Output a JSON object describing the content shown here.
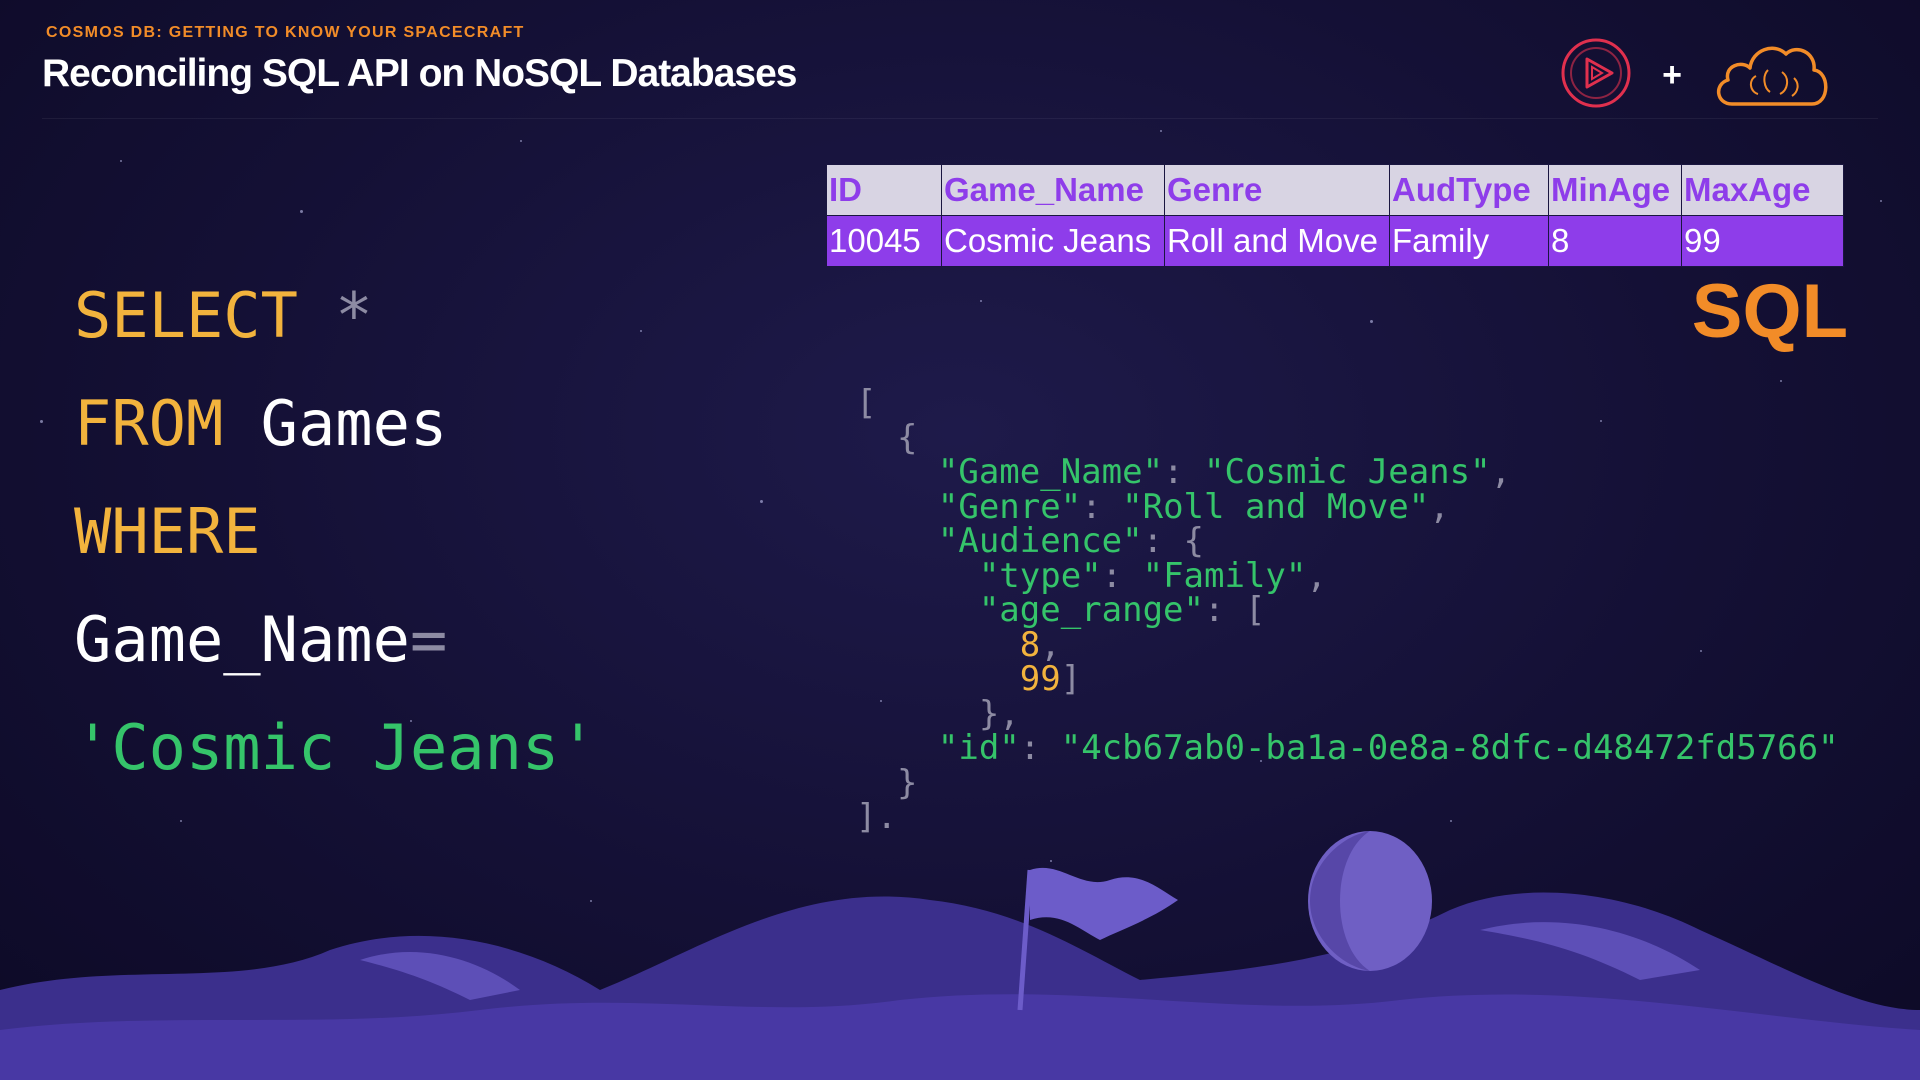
{
  "header": {
    "kicker": "COSMOS DB: GETTING TO KNOW YOUR SPACECRAFT",
    "title": "Reconciling SQL API on NoSQL Databases"
  },
  "logos": {
    "play_icon": "pluralsight-play-icon",
    "plus": "+",
    "cloud_icon": "cloud-brain-icon"
  },
  "sql_query": {
    "select_kw": "SELECT",
    "star": "*",
    "from_kw": "FROM",
    "table": "Games",
    "where_kw": "WHERE",
    "column": "Game_Name",
    "equals": "=",
    "value": "'Cosmic Jeans'"
  },
  "result_table": {
    "columns": [
      "ID",
      "Game_Name",
      "Genre",
      "AudType",
      "MinAge",
      "MaxAge"
    ],
    "rows": [
      [
        "10045",
        "Cosmic Jeans",
        "Roll and Move",
        "Family",
        "8",
        "99"
      ]
    ]
  },
  "sql_badge": "SQL",
  "json_doc": {
    "open_bracket": "[",
    "open_brace": "{",
    "k_game_name": "\"Game_Name\"",
    "v_game_name": "\"Cosmic Jeans\"",
    "k_genre": "\"Genre\"",
    "v_genre": "\"Roll and Move\"",
    "k_audience": "\"Audience\"",
    "k_type": "\"type\"",
    "v_type": "\"Family\"",
    "k_age_range": "\"age_range\"",
    "age_min": "8",
    "age_max": "99",
    "k_id": "\"id\"",
    "v_id": "\"4cb67ab0-ba1a-0e8a-8dfc-d48472fd5766\"",
    "close_brace": "}",
    "close_bracket": "]."
  },
  "colors": {
    "background": "#141035",
    "accent_orange": "#f28c28",
    "keyword_yellow": "#f2b33d",
    "string_green": "#35c46a",
    "table_purple": "#8e3dea",
    "play_red": "#e0304e"
  }
}
